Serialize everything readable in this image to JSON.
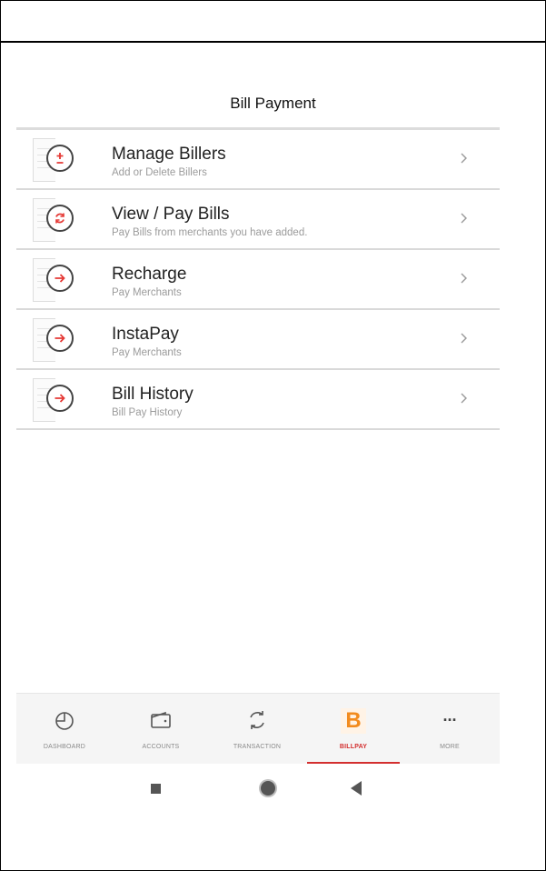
{
  "header": {
    "title": "Bill Payment"
  },
  "menu": [
    {
      "title": "Manage Billers",
      "subtitle": "Add or Delete Billers",
      "icon": "plus-minus-icon"
    },
    {
      "title": "View / Pay Bills",
      "subtitle": "Pay Bills from merchants you have added.",
      "icon": "refresh-icon"
    },
    {
      "title": "Recharge",
      "subtitle": "Pay Merchants",
      "icon": "arrow-right-icon"
    },
    {
      "title": "InstaPay",
      "subtitle": "Pay Merchants",
      "icon": "arrow-right-icon"
    },
    {
      "title": "Bill History",
      "subtitle": "Bill Pay History",
      "icon": "arrow-right-icon"
    }
  ],
  "tabs": [
    {
      "label": "DASHBOARD",
      "icon": "dashboard-icon"
    },
    {
      "label": "ACCOUNTS",
      "icon": "wallet-icon"
    },
    {
      "label": "TRANSACTION",
      "icon": "transfer-icon"
    },
    {
      "label": "BILLPAY",
      "icon": "billpay-icon",
      "glyph": "B",
      "active": true
    },
    {
      "label": "MORE",
      "icon": "more-icon",
      "glyph": "..."
    }
  ],
  "colors": {
    "accent": "#d32f2f",
    "billpay_orange": "#f28b1e"
  }
}
